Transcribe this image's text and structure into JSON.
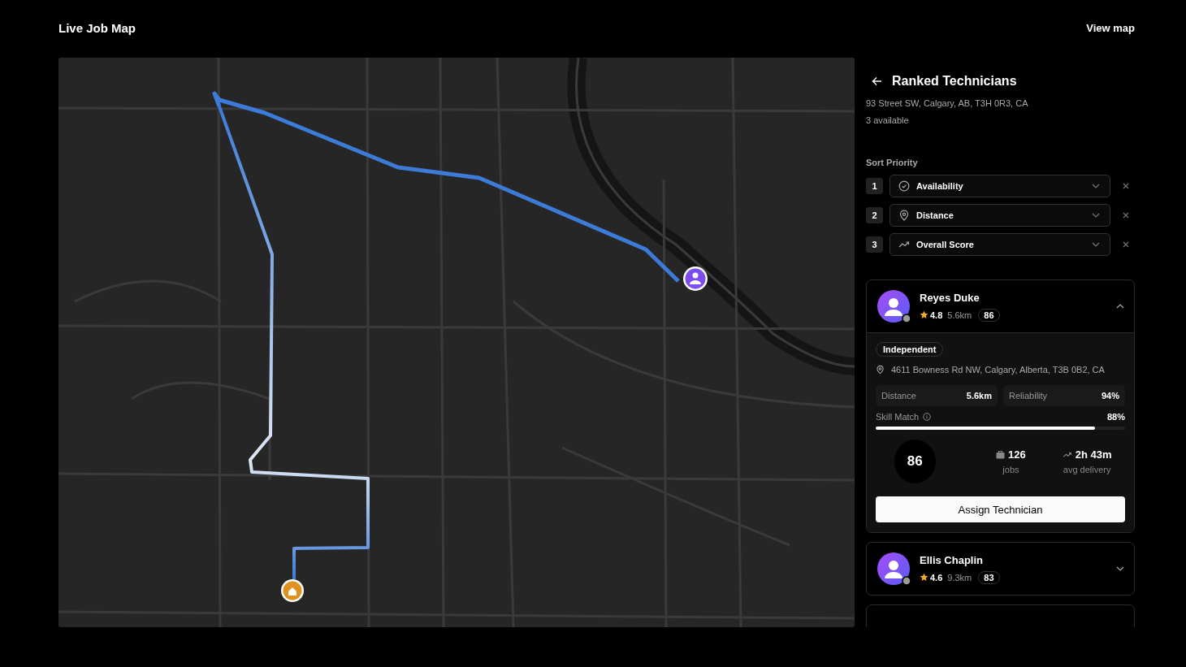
{
  "header": {
    "title": "Live Job Map",
    "view_map": "View map"
  },
  "panel": {
    "title": "Ranked Technicians",
    "address": "93 Street SW, Calgary, AB, T3H 0R3, CA",
    "available": "3 available",
    "sort_label": "Sort Priority",
    "sort_priority": [
      {
        "rank": "1",
        "kind": "availability",
        "label": "Availability"
      },
      {
        "rank": "2",
        "kind": "distance",
        "label": "Distance"
      },
      {
        "rank": "3",
        "kind": "score",
        "label": "Overall Score"
      }
    ]
  },
  "technicians": [
    {
      "name": "Reyes Duke",
      "rating": "4.8",
      "distance": "5.6km",
      "score": "86",
      "expanded": true,
      "type": "Independent",
      "address": "4611 Bowness Rd NW, Calgary, Alberta, T3B 0B2, CA",
      "distance_label": "Distance",
      "distance_value": "5.6km",
      "reliability_label": "Reliability",
      "reliability_value": "94%",
      "skill_label": "Skill Match",
      "skill_value": "88%",
      "level": 0.88,
      "big_score": "86",
      "jobs": "126",
      "jobs_label": "jobs",
      "delivery": "2h 43m",
      "delivery_label": "avg delivery",
      "assign": "Assign Technician"
    },
    {
      "name": "Ellis Chaplin",
      "rating": "4.6",
      "distance": "9.3km",
      "score": "83",
      "expanded": false
    }
  ]
}
